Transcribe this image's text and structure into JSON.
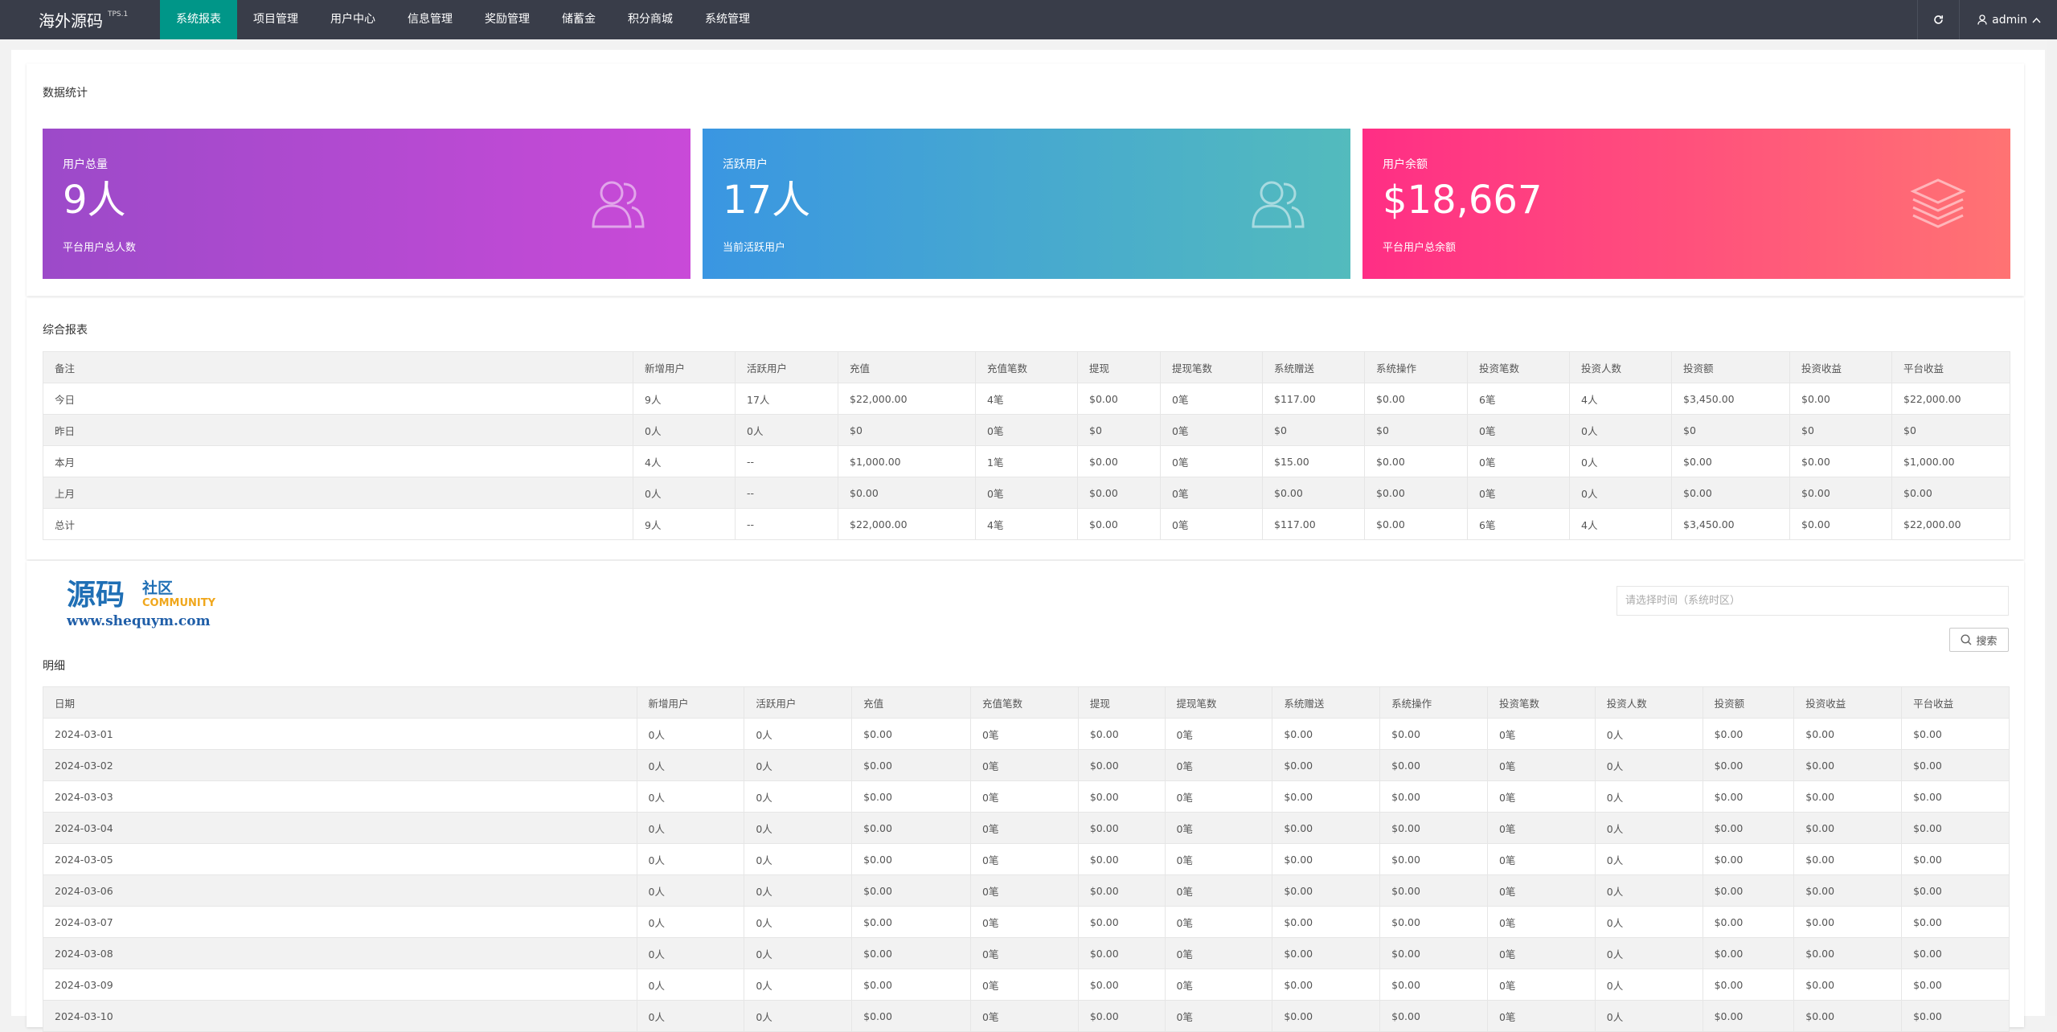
{
  "header": {
    "logo_text": "海外源码",
    "logo_version": "TPS.1",
    "nav": [
      "系统报表",
      "项目管理",
      "用户中心",
      "信息管理",
      "奖励管理",
      "储蓄金",
      "积分商城",
      "系统管理"
    ],
    "active_nav": "系统报表",
    "username": "admin"
  },
  "stats": {
    "title": "数据统计",
    "cards": [
      {
        "label": "用户总量",
        "value": "9人",
        "desc": "平台用户总人数",
        "icon": "users-icon"
      },
      {
        "label": "活跃用户",
        "value": "17人",
        "desc": "当前活跃用户",
        "icon": "users-icon"
      },
      {
        "label": "用户余额",
        "value": "$18,667",
        "desc": "平台用户总余额",
        "icon": "layers-icon"
      }
    ]
  },
  "summary": {
    "title": "综合报表",
    "columns": [
      "备注",
      "新增用户",
      "活跃用户",
      "充值",
      "充值笔数",
      "提现",
      "提现笔数",
      "系统赠送",
      "系统操作",
      "投资笔数",
      "投资人数",
      "投资额",
      "投资收益",
      "平台收益"
    ],
    "rows": [
      [
        "今日",
        "9人",
        "17人",
        "$22,000.00",
        "4笔",
        "$0.00",
        "0笔",
        "$117.00",
        "$0.00",
        "6笔",
        "4人",
        "$3,450.00",
        "$0.00",
        "$22,000.00"
      ],
      [
        "昨日",
        "0人",
        "0人",
        "$0",
        "0笔",
        "$0",
        "0笔",
        "$0",
        "$0",
        "0笔",
        "0人",
        "$0",
        "$0",
        "$0"
      ],
      [
        "本月",
        "4人",
        "--",
        "$1,000.00",
        "1笔",
        "$0.00",
        "0笔",
        "$15.00",
        "$0.00",
        "0笔",
        "0人",
        "$0.00",
        "$0.00",
        "$1,000.00"
      ],
      [
        "上月",
        "0人",
        "--",
        "$0.00",
        "0笔",
        "$0.00",
        "0笔",
        "$0.00",
        "$0.00",
        "0笔",
        "0人",
        "$0.00",
        "$0.00",
        "$0.00"
      ],
      [
        "总计",
        "9人",
        "--",
        "$22,000.00",
        "4笔",
        "$0.00",
        "0笔",
        "$117.00",
        "$0.00",
        "6笔",
        "4人",
        "$3,450.00",
        "$0.00",
        "$22,000.00"
      ]
    ]
  },
  "watermark": {
    "main": "源码",
    "sub": "社区",
    "community": "COMMUNITY",
    "url": "www.shequym.com"
  },
  "filter": {
    "date_placeholder": "请选择时间（系统时区）",
    "search_label": "搜索"
  },
  "detail": {
    "title": "明细",
    "columns": [
      "日期",
      "新增用户",
      "活跃用户",
      "充值",
      "充值笔数",
      "提现",
      "提现笔数",
      "系统赠送",
      "系统操作",
      "投资笔数",
      "投资人数",
      "投资额",
      "投资收益",
      "平台收益"
    ],
    "rows": [
      [
        "2024-03-01",
        "0人",
        "0人",
        "$0.00",
        "0笔",
        "$0.00",
        "0笔",
        "$0.00",
        "$0.00",
        "0笔",
        "0人",
        "$0.00",
        "$0.00",
        "$0.00"
      ],
      [
        "2024-03-02",
        "0人",
        "0人",
        "$0.00",
        "0笔",
        "$0.00",
        "0笔",
        "$0.00",
        "$0.00",
        "0笔",
        "0人",
        "$0.00",
        "$0.00",
        "$0.00"
      ],
      [
        "2024-03-03",
        "0人",
        "0人",
        "$0.00",
        "0笔",
        "$0.00",
        "0笔",
        "$0.00",
        "$0.00",
        "0笔",
        "0人",
        "$0.00",
        "$0.00",
        "$0.00"
      ],
      [
        "2024-03-04",
        "0人",
        "0人",
        "$0.00",
        "0笔",
        "$0.00",
        "0笔",
        "$0.00",
        "$0.00",
        "0笔",
        "0人",
        "$0.00",
        "$0.00",
        "$0.00"
      ],
      [
        "2024-03-05",
        "0人",
        "0人",
        "$0.00",
        "0笔",
        "$0.00",
        "0笔",
        "$0.00",
        "$0.00",
        "0笔",
        "0人",
        "$0.00",
        "$0.00",
        "$0.00"
      ],
      [
        "2024-03-06",
        "0人",
        "0人",
        "$0.00",
        "0笔",
        "$0.00",
        "0笔",
        "$0.00",
        "$0.00",
        "0笔",
        "0人",
        "$0.00",
        "$0.00",
        "$0.00"
      ],
      [
        "2024-03-07",
        "0人",
        "0人",
        "$0.00",
        "0笔",
        "$0.00",
        "0笔",
        "$0.00",
        "$0.00",
        "0笔",
        "0人",
        "$0.00",
        "$0.00",
        "$0.00"
      ],
      [
        "2024-03-08",
        "0人",
        "0人",
        "$0.00",
        "0笔",
        "$0.00",
        "0笔",
        "$0.00",
        "$0.00",
        "0笔",
        "0人",
        "$0.00",
        "$0.00",
        "$0.00"
      ],
      [
        "2024-03-09",
        "0人",
        "0人",
        "$0.00",
        "0笔",
        "$0.00",
        "0笔",
        "$0.00",
        "$0.00",
        "0笔",
        "0人",
        "$0.00",
        "$0.00",
        "$0.00"
      ],
      [
        "2024-03-10",
        "0人",
        "0人",
        "$0.00",
        "0笔",
        "$0.00",
        "0笔",
        "$0.00",
        "$0.00",
        "0笔",
        "0人",
        "$0.00",
        "$0.00",
        "$0.00"
      ]
    ]
  }
}
